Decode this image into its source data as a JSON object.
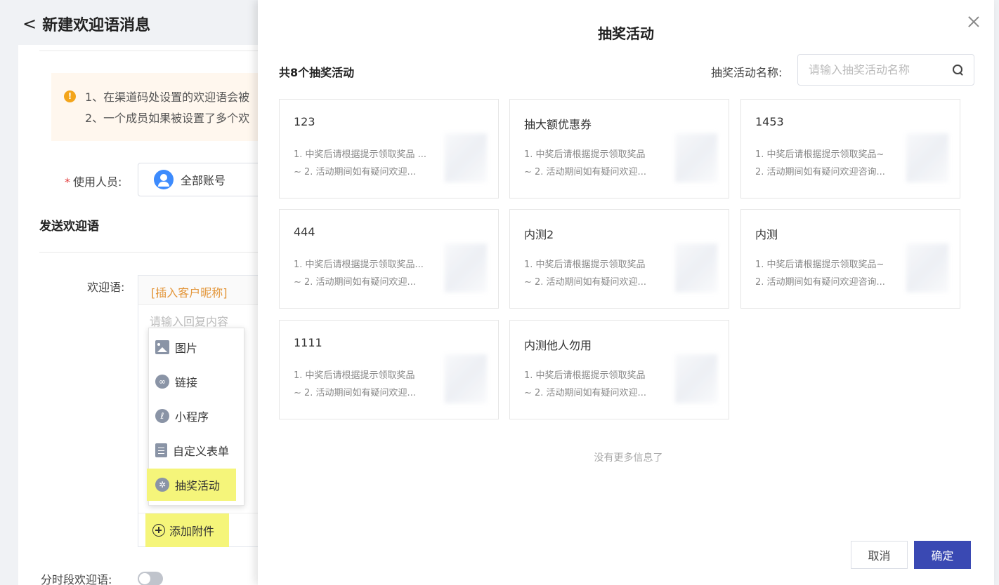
{
  "background": {
    "page_title": "新建欢迎语消息",
    "notice": {
      "line1": "1、在渠道码处设置的欢迎语会被",
      "line2": "2、一个成员如果被设置了多个欢"
    },
    "users_label": "使用人员:",
    "users_value": "全部账号",
    "section_title": "发送欢迎语",
    "welcome_label": "欢迎语:",
    "insert_nickname": "[插入客户昵称]",
    "reply_placeholder": "请输入回复内容",
    "add_attachment": "添加附件",
    "timed_label": "分时段欢迎语:"
  },
  "attach_menu": {
    "items": [
      {
        "label": "图片",
        "icon": "image-icon"
      },
      {
        "label": "链接",
        "icon": "link-icon"
      },
      {
        "label": "小程序",
        "icon": "mini-program-icon"
      },
      {
        "label": "自定义表单",
        "icon": "form-icon"
      },
      {
        "label": "抽奖活动",
        "icon": "lottery-icon"
      }
    ]
  },
  "modal": {
    "title": "抽奖活动",
    "count_text": "共8个抽奖活动",
    "search_label": "抽奖活动名称:",
    "search_placeholder": "请输入抽奖活动名称",
    "no_more": "没有更多信息了",
    "cancel": "取消",
    "confirm": "确定",
    "cards": [
      {
        "title": "123",
        "desc1": "1. 中奖后请根据提示领取奖品 ...",
        "desc2": "~ 2. 活动期间如有疑问欢迎..."
      },
      {
        "title": "抽大额优惠券",
        "desc1": "1. 中奖后请根据提示领取奖品",
        "desc2": "~ 2. 活动期间如有疑问欢迎..."
      },
      {
        "title": "1453",
        "desc1": "1. 中奖后请根据提示领取奖品~",
        "desc2": "2. 活动期间如有疑问欢迎咨询..."
      },
      {
        "title": "444",
        "desc1": "1. 中奖后请根据提示领取奖品...",
        "desc2": "~ 2. 活动期间如有疑问欢迎..."
      },
      {
        "title": "内测2",
        "desc1": "1. 中奖后请根据提示领取奖品",
        "desc2": "~ 2. 活动期间如有疑问欢迎..."
      },
      {
        "title": "内测",
        "desc1": "1. 中奖后请根据提示领取奖品~",
        "desc2": "2. 活动期间如有疑问欢迎咨询..."
      },
      {
        "title": "1111",
        "desc1": "1. 中奖后请根据提示领取奖品",
        "desc2": "~ 2. 活动期间如有疑问欢迎..."
      },
      {
        "title": "内测他人勿用",
        "desc1": "1. 中奖后请根据提示领取奖品",
        "desc2": "~ 2. 活动期间如有疑问欢迎..."
      }
    ]
  },
  "colors": {
    "primary": "#3a49b3",
    "highlight": "#f5f57a",
    "notice_bg": "#fff7ee",
    "warning": "#f3a51b"
  }
}
